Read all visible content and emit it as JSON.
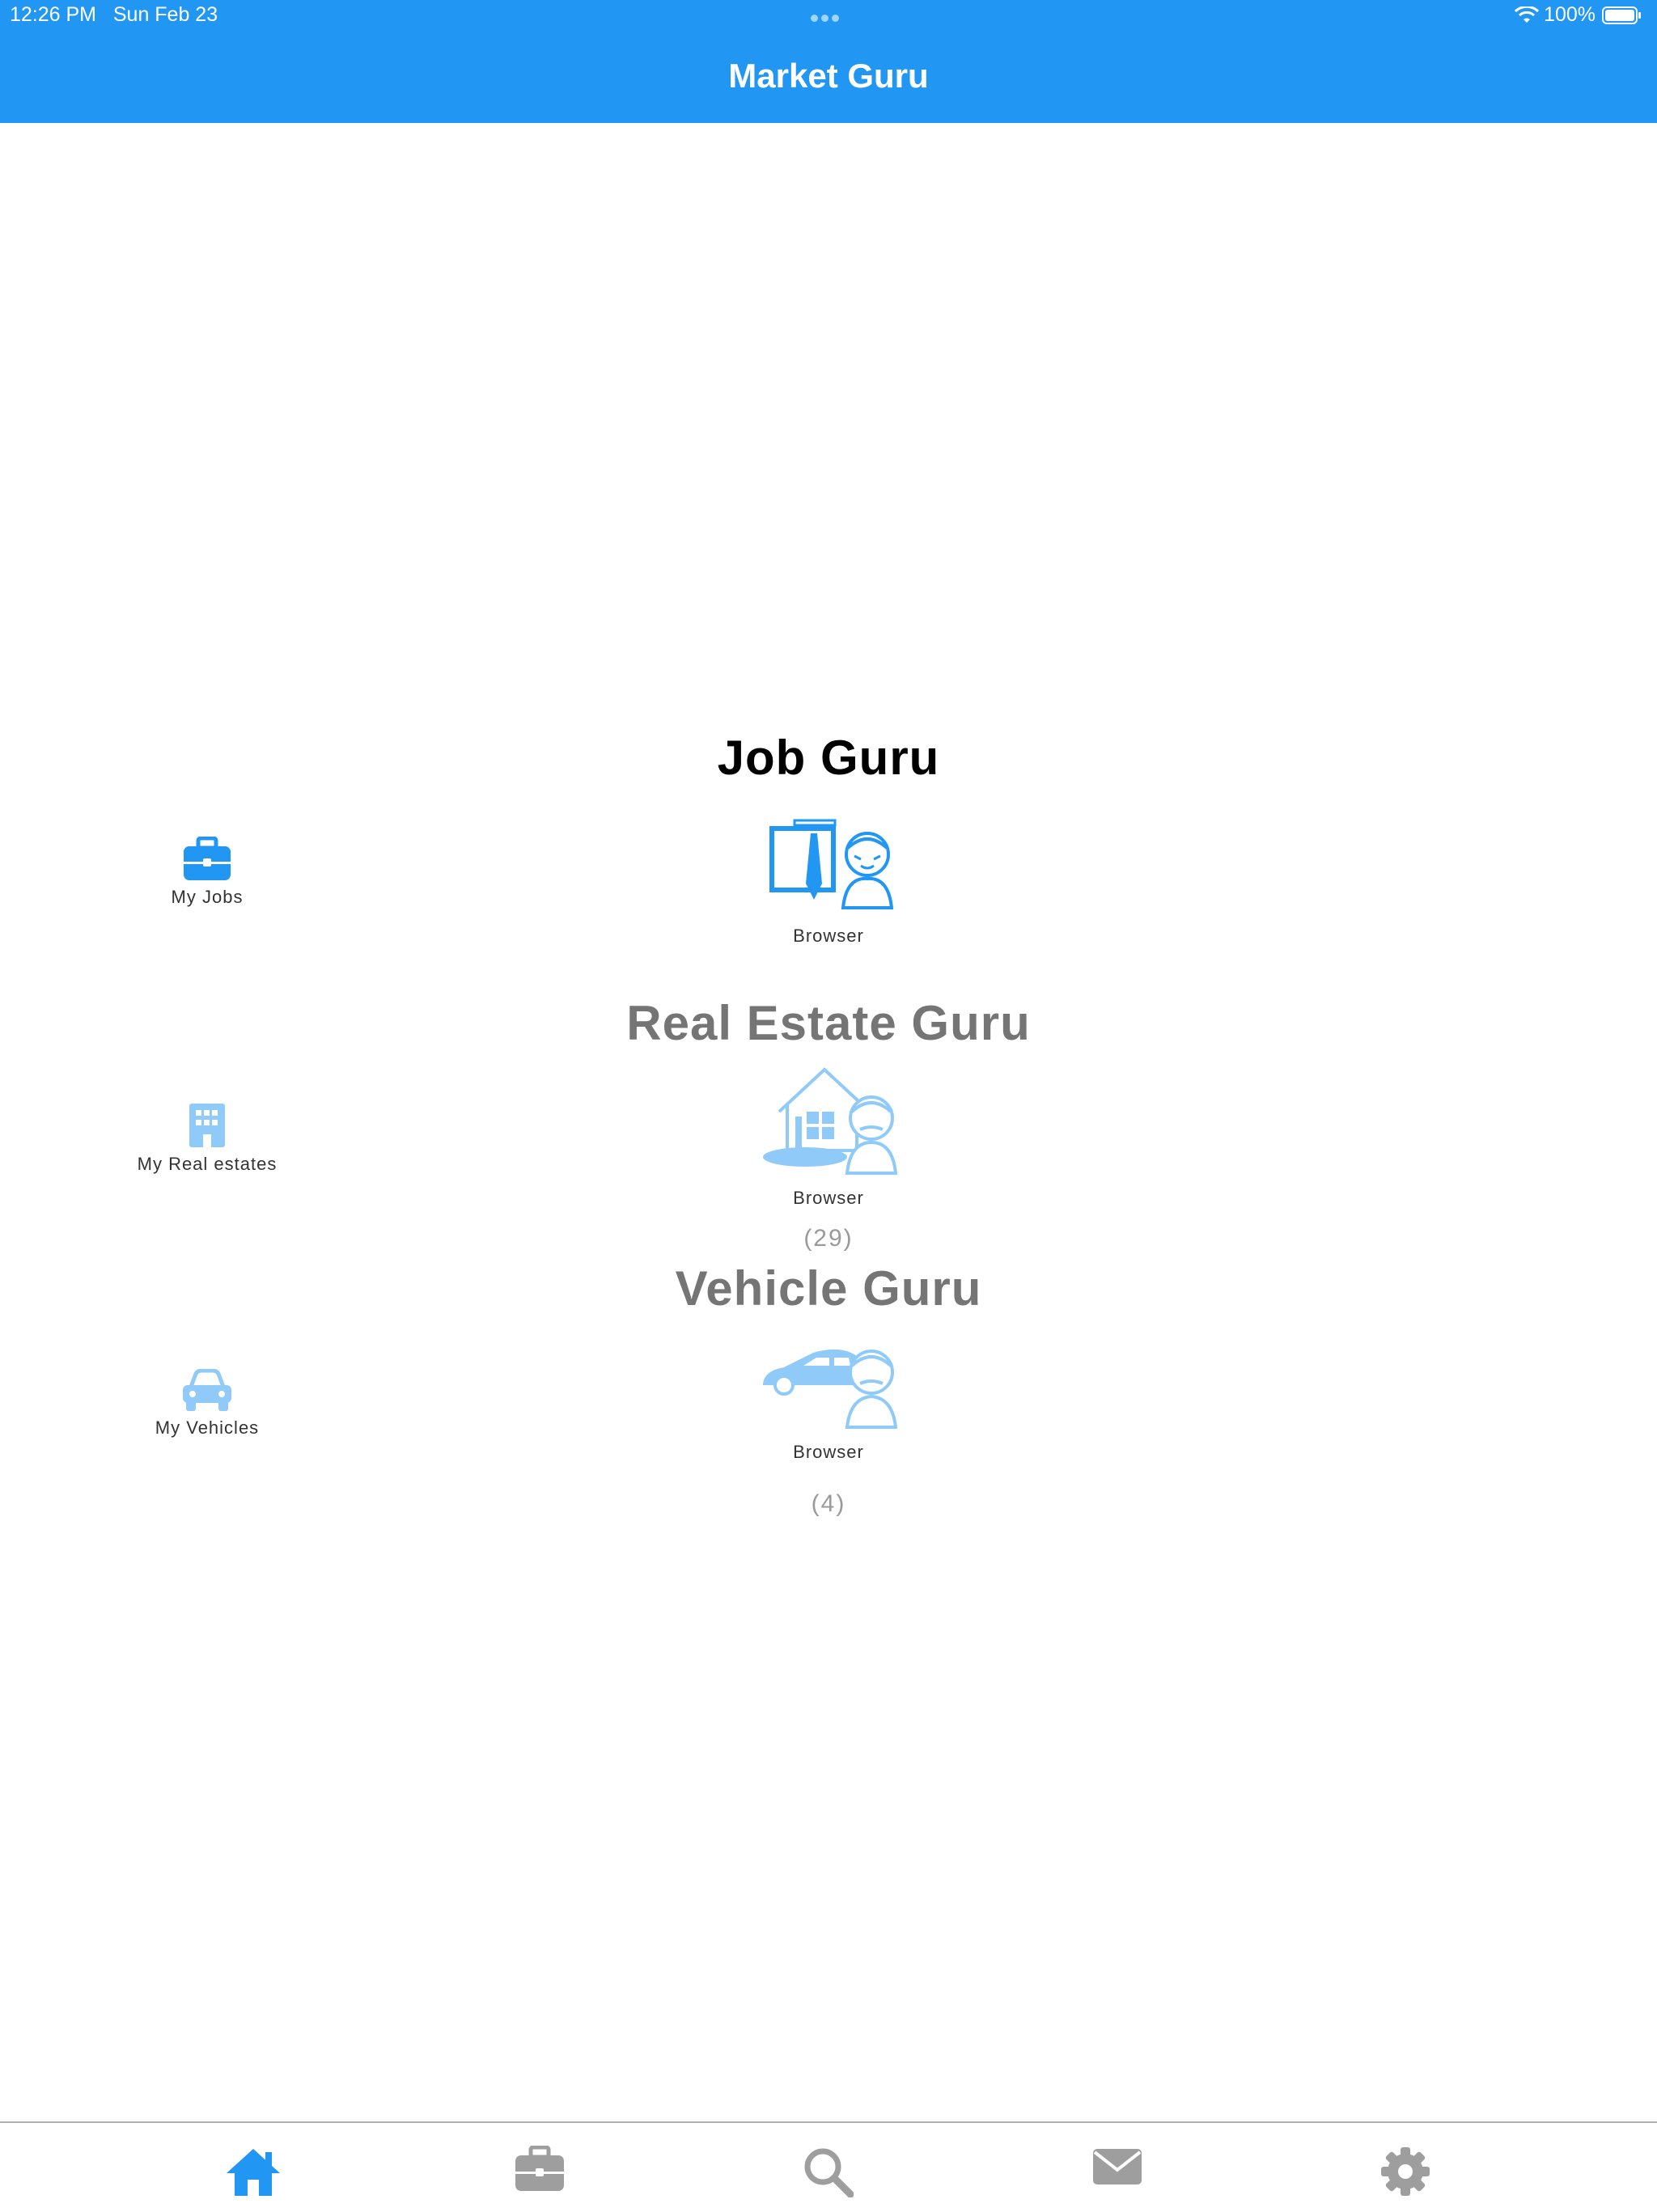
{
  "status_bar": {
    "time": "12:26 PM",
    "date": "Sun Feb 23",
    "battery": "100%"
  },
  "header": {
    "title": "Market Guru"
  },
  "sections": [
    {
      "title": "Job Guru",
      "side_label": "My Jobs",
      "side_icon": "briefcase-icon",
      "browser_label": "Browser",
      "count": "",
      "active": true
    },
    {
      "title": "Real Estate Guru",
      "side_label": "My Real estates",
      "side_icon": "building-icon",
      "browser_label": "Browser",
      "count": "(29)",
      "active": false
    },
    {
      "title": "Vehicle Guru",
      "side_label": "My Vehicles",
      "side_icon": "car-icon",
      "browser_label": "Browser",
      "count": "(4)",
      "active": false
    }
  ],
  "tabs": [
    {
      "icon": "home-icon",
      "active": true
    },
    {
      "icon": "briefcase-icon",
      "active": false
    },
    {
      "icon": "search-icon",
      "active": false
    },
    {
      "icon": "mail-icon",
      "active": false
    },
    {
      "icon": "gear-icon",
      "active": false
    }
  ],
  "colors": {
    "primary": "#2196f3",
    "light_blue": "#90caf9",
    "inactive_gray": "#9e9e9e",
    "title_gray": "#757575"
  }
}
